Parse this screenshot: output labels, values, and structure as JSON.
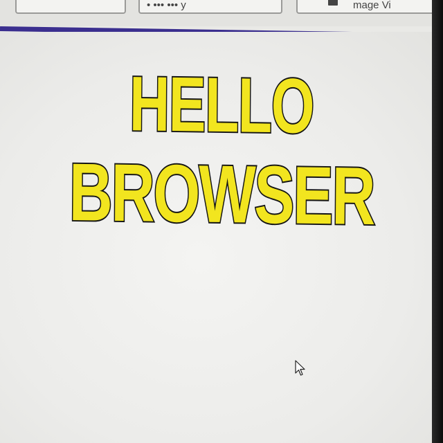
{
  "toolbar": {
    "buttons": [
      {
        "label": ""
      },
      {
        "label": "•  ••• ••• y"
      },
      {
        "label": "mage Vi"
      }
    ],
    "icon_b3": "image-icon"
  },
  "divider": {
    "color": "#3b2f8f"
  },
  "content": {
    "line1": "HELLO",
    "line2": "BROWSER",
    "text_color": "#f2e51f",
    "outline_color": "#141414"
  },
  "cursor": {
    "icon": "arrow-cursor-icon"
  }
}
